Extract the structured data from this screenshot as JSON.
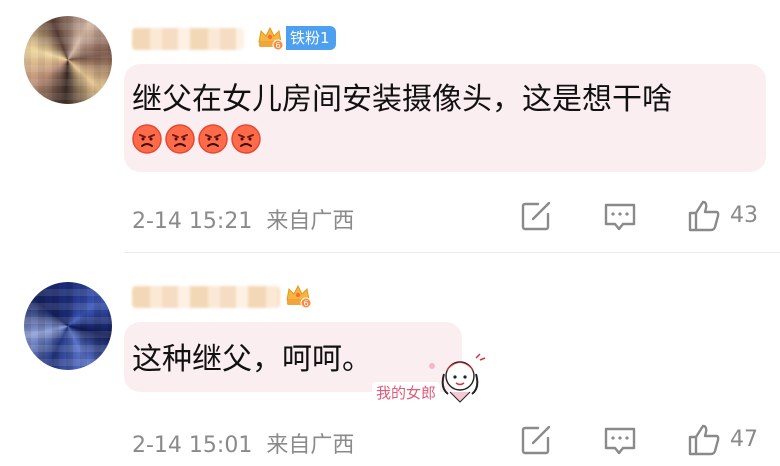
{
  "comments": [
    {
      "badge": {
        "fan_label": "铁粉1",
        "level": "6"
      },
      "text": "继父在女儿房间安装摄像头，这是想干啥",
      "emoji": [
        "angry-face",
        "angry-face",
        "angry-face",
        "angry-face"
      ],
      "time": "2-14 15:21",
      "location": "来自广西",
      "likes": "43"
    },
    {
      "badge": {
        "level": "6"
      },
      "text": "这种继父，呵呵。",
      "sticker": {
        "label": "我的女郎"
      },
      "time": "2-14 15:01",
      "location": "来自广西",
      "likes": "47"
    }
  ],
  "icons": [
    "share-icon",
    "reply-icon",
    "like-icon",
    "crown-icon",
    "angry-face-icon"
  ],
  "colors": {
    "bubble": "#fbeef1",
    "fan_badge": "#4da0f0",
    "meta_text": "#8a8a8a"
  }
}
